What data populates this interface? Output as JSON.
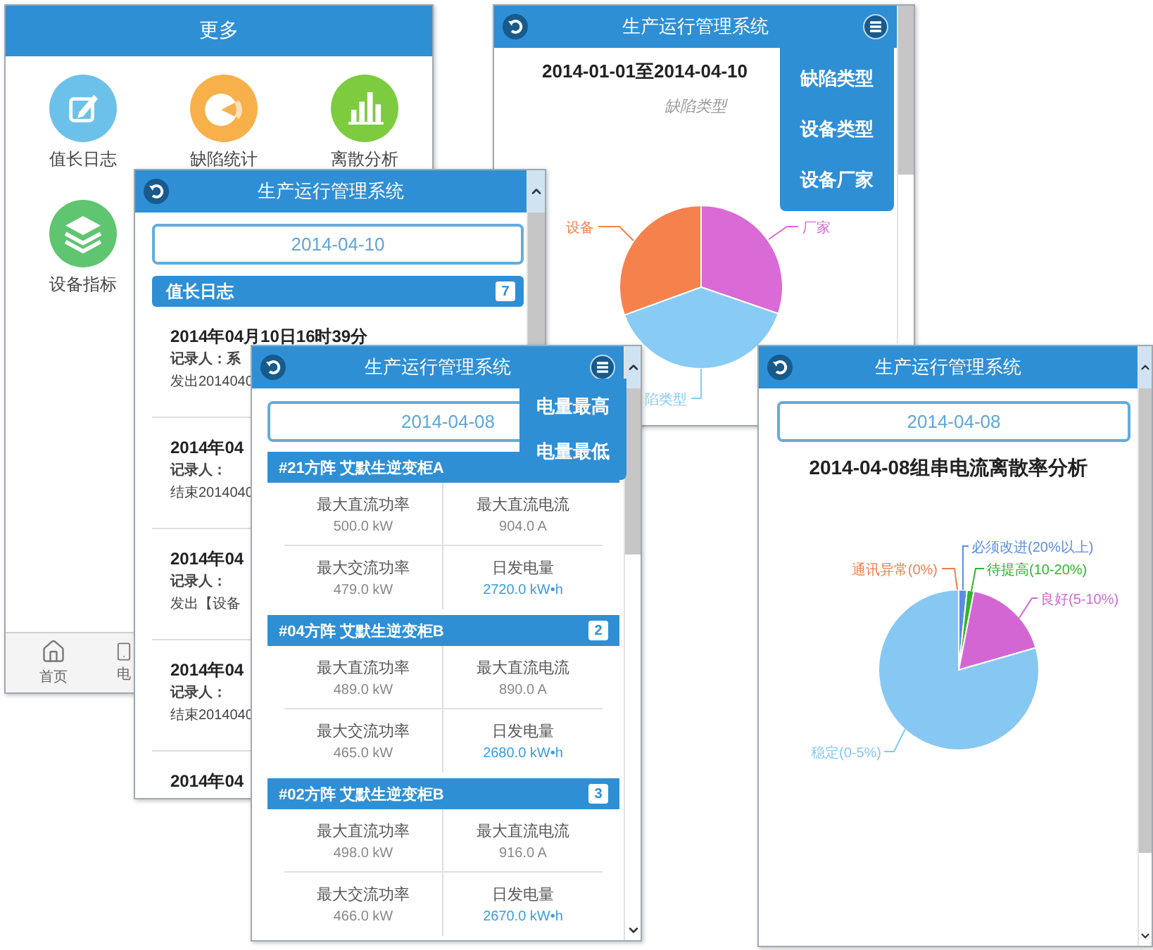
{
  "more_screen": {
    "title": "更多",
    "tiles": [
      {
        "label": "值长日志",
        "kind": "edit"
      },
      {
        "label": "缺陷统计",
        "kind": "pie"
      },
      {
        "label": "离散分析",
        "kind": "bars"
      },
      {
        "label": "设备指标",
        "kind": "layers"
      }
    ],
    "tab_bar": [
      {
        "label": "首页",
        "kind": "home"
      },
      {
        "label": "电",
        "kind": "device"
      }
    ]
  },
  "defect_screen": {
    "title": "生产运行管理系统",
    "heading": "2014-01-01至2014-04-10",
    "subtitle": "缺陷类型",
    "menu": [
      "缺陷类型",
      "设备类型",
      "设备厂家"
    ],
    "pie": [
      {
        "label": "厂家",
        "color": "#d96ad6"
      },
      {
        "label": "陷类型",
        "color": "#88cbf5"
      },
      {
        "label": "设备",
        "color": "#f5814d"
      }
    ]
  },
  "log_screen": {
    "title": "生产运行管理系统",
    "date": "2014-04-10",
    "section": {
      "title": "值长日志",
      "count": "7"
    },
    "entries": [
      {
        "time": "2014年04月10日16时39分",
        "recorder": "记录人：系",
        "summary": "发出2014040"
      },
      {
        "time": "2014年04",
        "recorder": "记录人：",
        "summary": "结束2014040"
      },
      {
        "time": "2014年04",
        "recorder": "记录人：",
        "summary": "发出【设备"
      },
      {
        "time": "2014年04",
        "recorder": "记录人：",
        "summary": "结束2014040"
      },
      {
        "time": "2014年04"
      }
    ]
  },
  "inverter_screen": {
    "title": "生产运行管理系统",
    "date": "2014-04-08",
    "menu": [
      "电量最高",
      "电量最低"
    ],
    "groups": [
      {
        "title": "#21方阵 艾默生逆变柜A",
        "stats": [
          {
            "label": "最大直流功率",
            "value": "500.0 kW",
            "highlighted": false
          },
          {
            "label": "最大直流电流",
            "value": "904.0 A",
            "highlighted": false
          },
          {
            "label": "最大交流功率",
            "value": "479.0 kW",
            "highlighted": false
          },
          {
            "label": "日发电量",
            "value": "2720.0 kW•h",
            "highlighted": true
          }
        ]
      },
      {
        "title": "#04方阵 艾默生逆变柜B",
        "count": "2",
        "stats": [
          {
            "label": "最大直流功率",
            "value": "489.0 kW",
            "highlighted": false
          },
          {
            "label": "最大直流电流",
            "value": "890.0 A",
            "highlighted": false
          },
          {
            "label": "最大交流功率",
            "value": "465.0 kW",
            "highlighted": false
          },
          {
            "label": "日发电量",
            "value": "2680.0 kW•h",
            "highlighted": true
          }
        ]
      },
      {
        "title": "#02方阵 艾默生逆变柜B",
        "count": "3",
        "stats": [
          {
            "label": "最大直流功率",
            "value": "498.0 kW",
            "highlighted": false
          },
          {
            "label": "最大直流电流",
            "value": "916.0 A",
            "highlighted": false
          },
          {
            "label": "最大交流功率",
            "value": "466.0 kW",
            "highlighted": false
          },
          {
            "label": "日发电量",
            "value": "2670.0 kW•h",
            "highlighted": true
          }
        ]
      }
    ]
  },
  "dispersion_screen": {
    "title": "生产运行管理系统",
    "date": "2014-04-08",
    "heading": "2014-04-08组串电流离散率分析",
    "pie": [
      {
        "label": "必须改进(20%以上)",
        "color": "#5b8de3"
      },
      {
        "label": "待提高(10-20%)",
        "color": "#2fb52f"
      },
      {
        "label": "良好(5-10%)",
        "color": "#d466d4"
      },
      {
        "label": "稳定(0-5%)",
        "color": "#86c8f2"
      },
      {
        "label": "通讯异常(0%)",
        "color": "#f47c4e"
      }
    ]
  }
}
